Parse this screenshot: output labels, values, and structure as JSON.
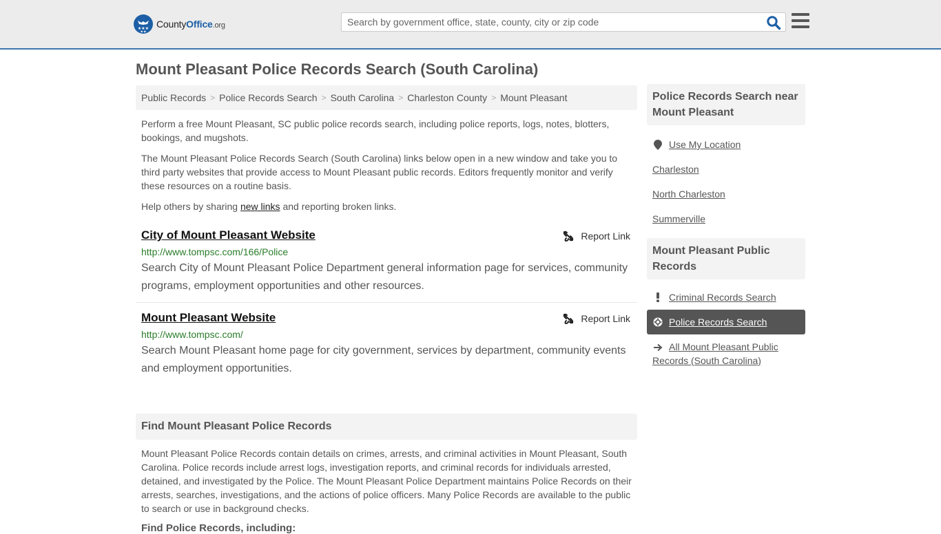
{
  "header": {
    "logo": {
      "name_part1": "County",
      "name_part2": "Office",
      "tld": ".org"
    },
    "search": {
      "placeholder": "Search by government office, state, county, city or zip code",
      "value": ""
    },
    "icons": {
      "search": "search-icon",
      "menu": "hamburger-menu-icon"
    }
  },
  "page": {
    "title": "Mount Pleasant Police Records Search (South Carolina)"
  },
  "breadcrumb": [
    {
      "label": "Public Records"
    },
    {
      "label": "Police Records Search"
    },
    {
      "label": "South Carolina"
    },
    {
      "label": "Charleston County"
    },
    {
      "label": "Mount Pleasant"
    }
  ],
  "intro": {
    "p1": "Perform a free Mount Pleasant, SC public police records search, including police reports, logs, notes, blotters, bookings, and mugshots.",
    "p2": "The Mount Pleasant Police Records Search (South Carolina) links below open in a new window and take you to third party websites that provide access to Mount Pleasant public records. Editors frequently monitor and verify these resources on a routine basis.",
    "p3_before": "Help others by sharing ",
    "p3_link": "new links",
    "p3_after": " and reporting broken links."
  },
  "links": [
    {
      "title": "City of Mount Pleasant Website",
      "url": "http://www.tompsc.com/166/Police",
      "description": "Search City of Mount Pleasant Police Department general information page for services, community programs, employment opportunities and other resources.",
      "report_label": "Report Link"
    },
    {
      "title": "Mount Pleasant Website",
      "url": "http://www.tompsc.com/",
      "description": "Search Mount Pleasant home page for city government, services by department, community events and employment opportunities.",
      "report_label": "Report Link"
    }
  ],
  "find_section": {
    "heading": "Find Mount Pleasant Police Records",
    "body": "Mount Pleasant Police Records contain details on crimes, arrests, and criminal activities in Mount Pleasant, South Carolina. Police records include arrest logs, investigation reports, and criminal records for individuals arrested, detained, and investigated by the Police. The Mount Pleasant Police Department maintains Police Records on their arrests, searches, investigations, and the actions of police officers. Many Police Records are available to the public to search or use in background checks.",
    "subheading": "Find Police Records, including:"
  },
  "sidebar": {
    "nearby": {
      "heading": "Police Records Search near Mount Pleasant",
      "use_location": "Use My Location",
      "places": [
        "Charleston",
        "North Charleston",
        "Summerville"
      ]
    },
    "public_records": {
      "heading": "Mount Pleasant Public Records",
      "items": [
        {
          "label": "Criminal Records Search",
          "icon": "exclamation-icon",
          "active": false
        },
        {
          "label": "Police Records Search",
          "icon": "crosshair-icon",
          "active": true
        },
        {
          "label": "All Mount Pleasant Public Records (South Carolina)",
          "icon": "arrow-right-icon",
          "active": false
        }
      ]
    }
  },
  "colors": {
    "accent": "#3c76ad",
    "brand_blue": "#1d5fa6",
    "url_green": "#2a7d2a",
    "active_bg": "#555555",
    "panel_bg": "#f3f3f3"
  }
}
